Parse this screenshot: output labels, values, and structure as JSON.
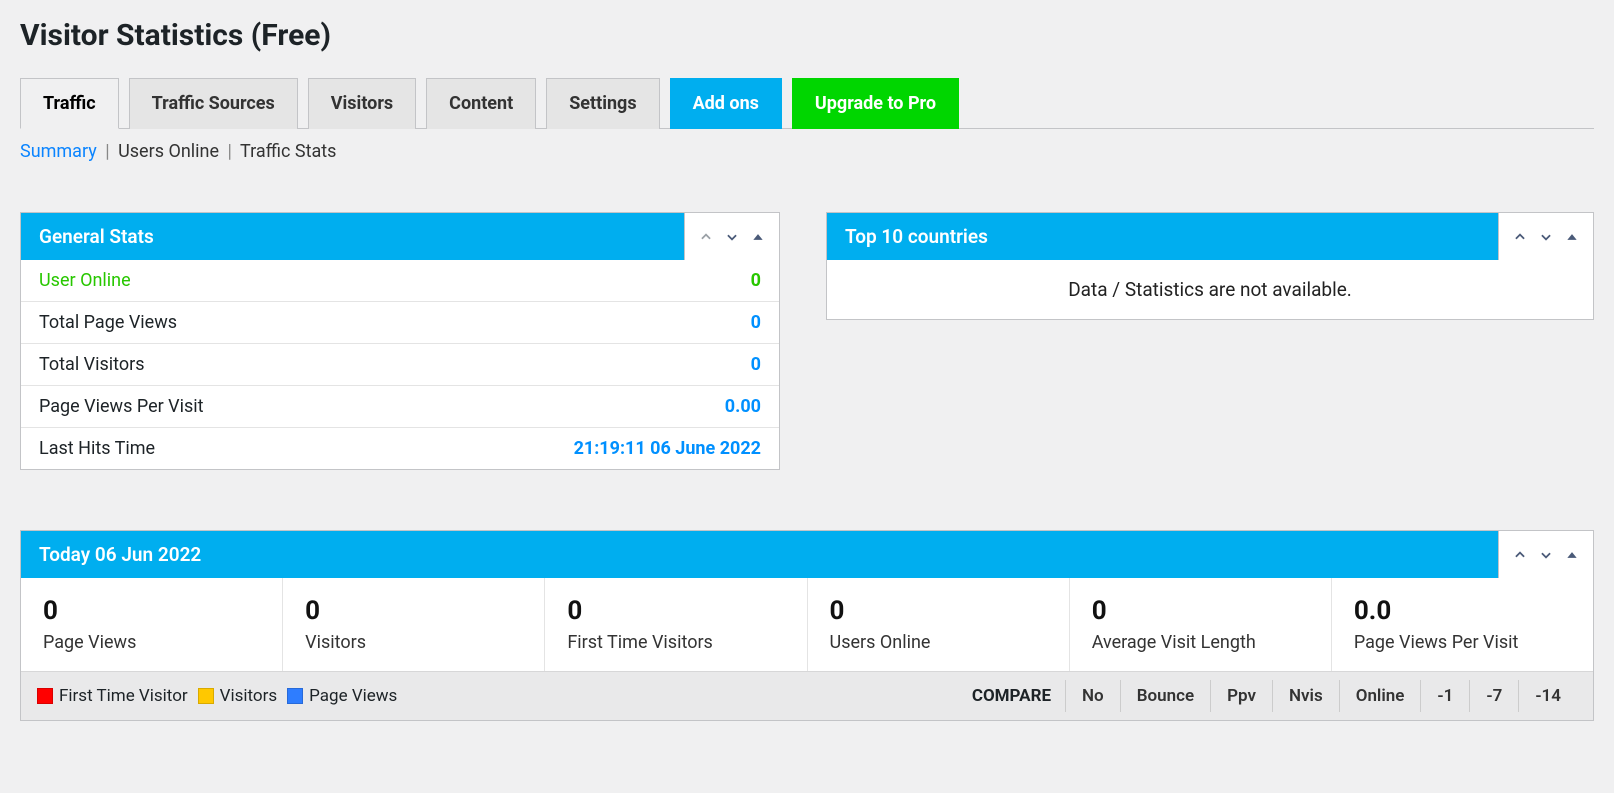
{
  "page_title": "Visitor Statistics (Free)",
  "tabs": {
    "traffic": "Traffic",
    "traffic_sources": "Traffic Sources",
    "visitors": "Visitors",
    "content": "Content",
    "settings": "Settings",
    "addons": "Add ons",
    "upgrade": "Upgrade to Pro"
  },
  "subnav": {
    "summary": "Summary",
    "users_online": "Users Online",
    "traffic_stats": "Traffic Stats"
  },
  "general_stats": {
    "title": "General Stats",
    "rows": {
      "user_online": {
        "label": "User Online",
        "value": "0"
      },
      "total_page_views": {
        "label": "Total Page Views",
        "value": "0"
      },
      "total_visitors": {
        "label": "Total Visitors",
        "value": "0"
      },
      "page_views_per_visit": {
        "label": "Page Views Per Visit",
        "value": "0.00"
      },
      "last_hits_time": {
        "label": "Last Hits Time",
        "value": "21:19:11 06 June 2022"
      }
    }
  },
  "top_countries": {
    "title": "Top 10 countries",
    "no_data": "Data / Statistics are not available."
  },
  "today": {
    "title": "Today  06 Jun 2022",
    "cards": {
      "page_views": {
        "num": "0",
        "lbl": "Page Views"
      },
      "visitors": {
        "num": "0",
        "lbl": "Visitors"
      },
      "first_time_visitors": {
        "num": "0",
        "lbl": "First Time Visitors"
      },
      "users_online": {
        "num": "0",
        "lbl": "Users Online"
      },
      "avg_visit_length": {
        "num": "0",
        "lbl": "Average Visit Length"
      },
      "pvpv": {
        "num": "0.0",
        "lbl": "Page Views Per Visit"
      }
    },
    "legend": {
      "first_time_visitor": "First Time Visitor",
      "visitors": "Visitors",
      "page_views": "Page Views"
    },
    "compare": {
      "label": "COMPARE",
      "no": "No",
      "bounce": "Bounce",
      "ppv": "Ppv",
      "nvis": "Nvis",
      "online": "Online",
      "m1": "-1",
      "m7": "-7",
      "m14": "-14"
    }
  }
}
